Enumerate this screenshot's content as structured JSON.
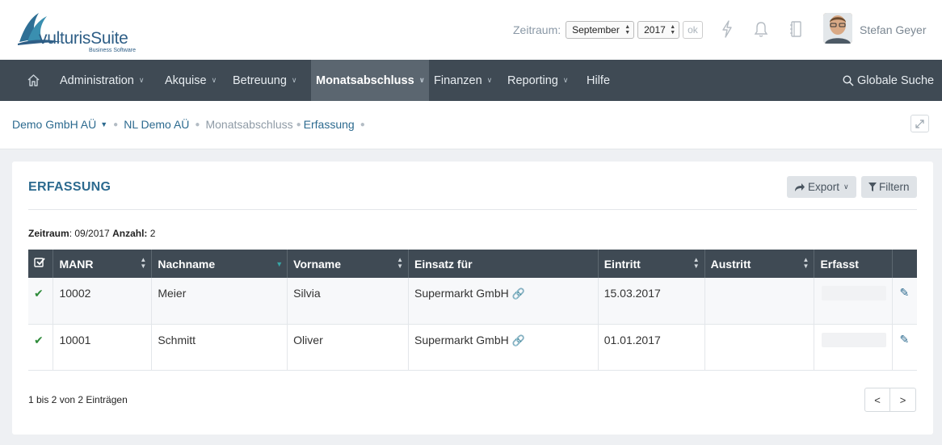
{
  "header": {
    "logo_text": "vulturisSuite",
    "logo_sub": "Business Software",
    "zeitraum_label": "Zeitraum:",
    "month_value": "September",
    "year_value": "2017",
    "ok_label": "ok",
    "user_name": "Stefan Geyer"
  },
  "nav": {
    "items": [
      {
        "label": "Administration"
      },
      {
        "label": "Akquise"
      },
      {
        "label": "Betreuung"
      },
      {
        "label": "Monatsabschluss"
      },
      {
        "label": "Finanzen"
      },
      {
        "label": "Reporting"
      },
      {
        "label": "Hilfe"
      }
    ],
    "search_label": "Globale Suche"
  },
  "breadcrumb": {
    "company": "Demo GmbH AÜ",
    "branch": "NL Demo AÜ",
    "section": "Monatsabschluss",
    "page": "Erfassung"
  },
  "panel": {
    "title": "ERFASSUNG",
    "export_label": "Export",
    "filter_label": "Filtern",
    "summary_zeitraum_label": "Zeitraum",
    "summary_zeitraum_value": ": 09/2017 ",
    "summary_anzahl_label": "Anzahl:",
    "summary_anzahl_value": " 2"
  },
  "table": {
    "columns": [
      "MANR",
      "Nachname",
      "Vorname",
      "Einsatz für",
      "Eintritt",
      "Austritt",
      "Erfasst"
    ],
    "rows": [
      {
        "manr": "10002",
        "nachname": "Meier",
        "vorname": "Silvia",
        "einsatz": "Supermarkt GmbH",
        "eintritt": "15.03.2017",
        "austritt": ""
      },
      {
        "manr": "10001",
        "nachname": "Schmitt",
        "vorname": "Oliver",
        "einsatz": "Supermarkt GmbH",
        "eintritt": "01.01.2017",
        "austritt": ""
      }
    ]
  },
  "footer": {
    "count_text": "1 bis 2 von 2 Einträgen",
    "prev_label": "<",
    "next_label": ">"
  },
  "colors": {
    "nav_bg": "#3f4a54",
    "accent": "#2c6a8f",
    "check": "#2e8b3a"
  }
}
